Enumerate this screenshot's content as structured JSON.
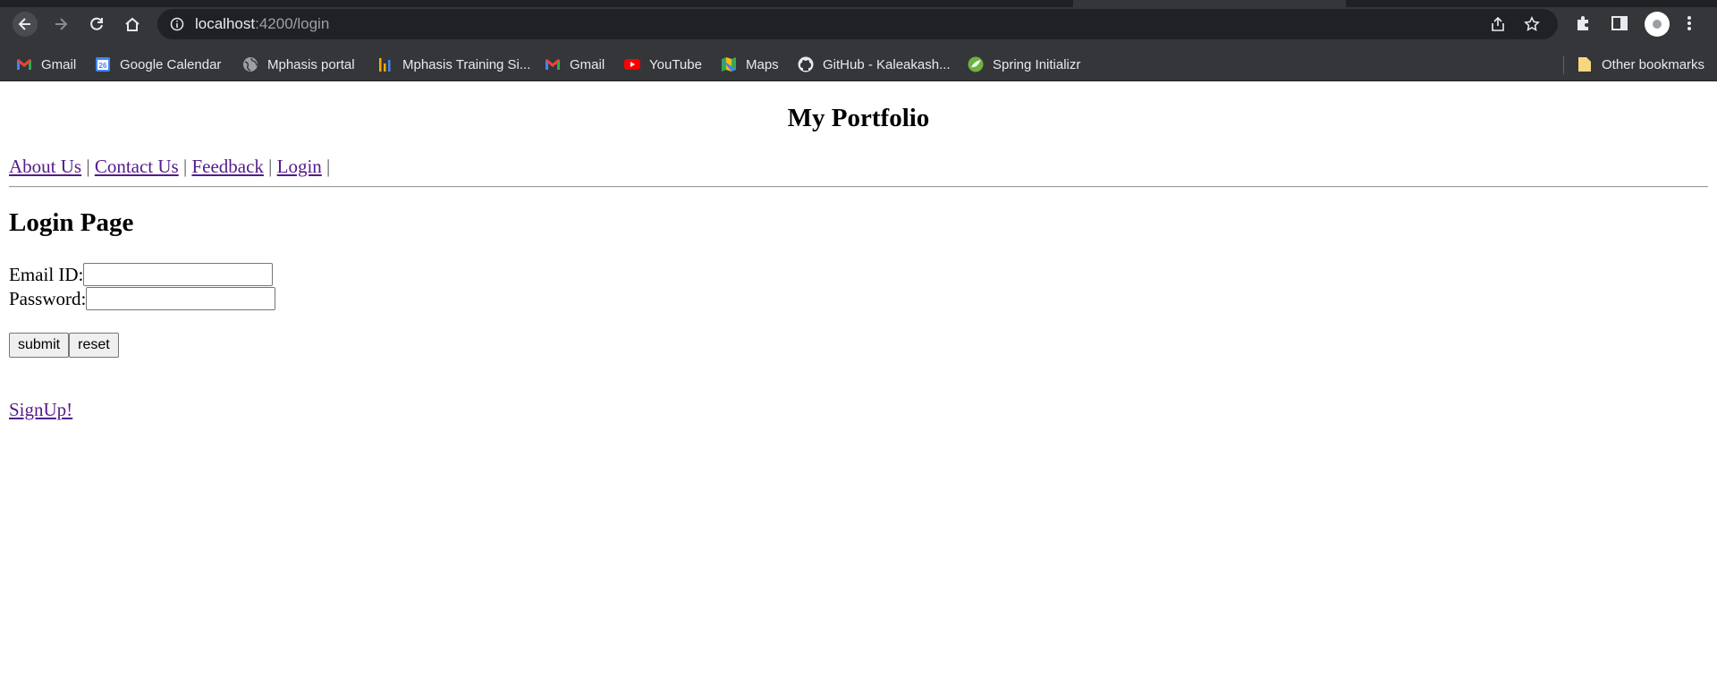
{
  "browser": {
    "url_host": "localhost",
    "url_path": ":4200/login",
    "bookmarks": [
      {
        "label": "Gmail",
        "icon": "gmail-icon"
      },
      {
        "label": "Google Calendar",
        "icon": "google-calendar-icon"
      },
      {
        "label": "Mphasis portal",
        "icon": "globe-icon"
      },
      {
        "label": "Mphasis Training Si...",
        "icon": "bar-chart-icon"
      },
      {
        "label": "Gmail",
        "icon": "gmail-icon"
      },
      {
        "label": "YouTube",
        "icon": "youtube-icon"
      },
      {
        "label": "Maps",
        "icon": "maps-icon"
      },
      {
        "label": "GitHub - Kaleakash...",
        "icon": "github-icon"
      },
      {
        "label": "Spring Initializr",
        "icon": "spring-icon"
      }
    ],
    "other_bookmarks": "Other bookmarks",
    "calendar_day": "26"
  },
  "page": {
    "title": "My Portfolio",
    "nav": [
      {
        "label": "About Us"
      },
      {
        "label": "Contact Us"
      },
      {
        "label": "Feedback"
      },
      {
        "label": "Login"
      }
    ],
    "nav_separator": "|",
    "login_heading": "Login Page",
    "email_label": "Email ID:",
    "email_value": "",
    "password_label": "Password:",
    "password_value": "",
    "submit_label": "submit",
    "reset_label": "reset",
    "signup_label": "SignUp!"
  }
}
